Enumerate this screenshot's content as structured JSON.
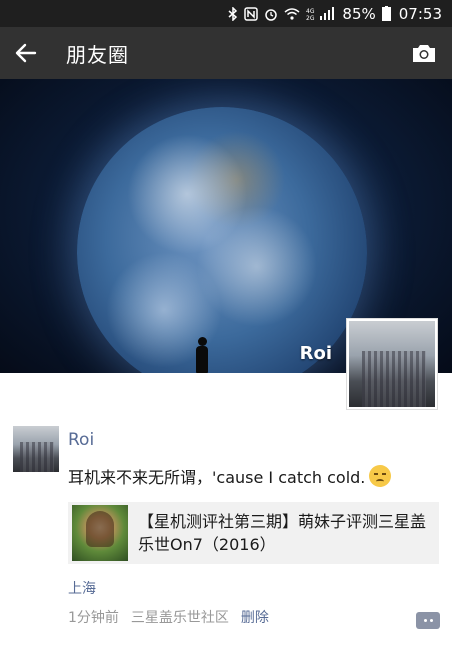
{
  "status_bar": {
    "icons": [
      "bluetooth-icon",
      "nfc-icon",
      "alarm-icon",
      "wifi-icon",
      "4g-signal-icon",
      "battery-icon"
    ],
    "battery_percent": "85%",
    "time": "07:53"
  },
  "header": {
    "title": "朋友圈",
    "back_icon": "back-arrow-icon",
    "camera_icon": "camera-icon"
  },
  "cover": {
    "user_name": "Roi"
  },
  "post": {
    "author": "Roi",
    "text": "耳机来不来无所谓，'cause I catch cold.",
    "emoji": "pensive-emoji",
    "link_card": {
      "title": "【星机测评社第三期】萌妹子评测三星盖乐世On7（2016）"
    },
    "location": "上海",
    "time": "1分钟前",
    "source": "三星盖乐世社区",
    "delete_label": "删除"
  },
  "colors": {
    "status_bar_bg": "#1f1f1f",
    "header_bg": "#323232",
    "link_blue": "#576b95",
    "meta_gray": "#999999",
    "card_bg": "#f1f1f1"
  }
}
